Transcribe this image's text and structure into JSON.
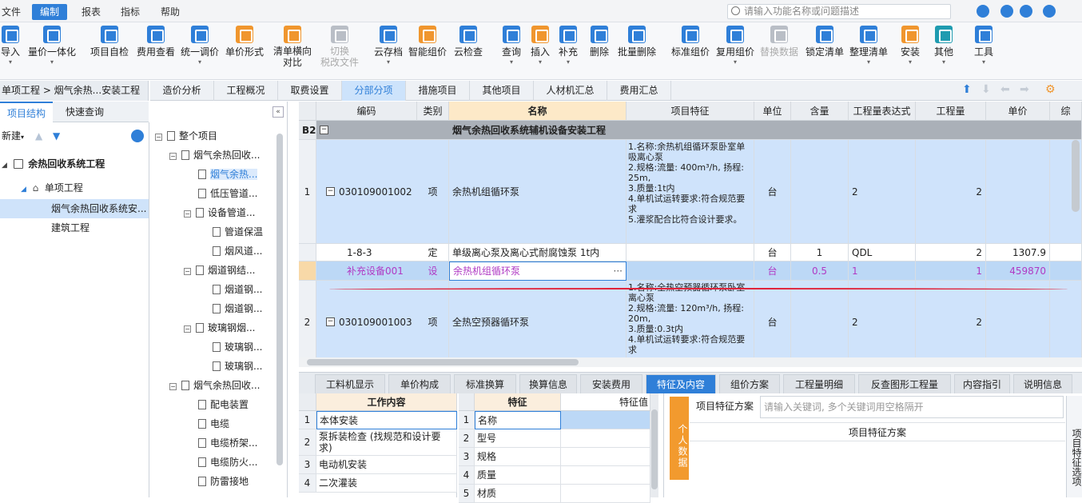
{
  "menu": {
    "items": [
      "文件",
      "编制",
      "报表",
      "指标",
      "帮助"
    ],
    "search_placeholder": "请输入功能名称或问题描述"
  },
  "toolbar": {
    "items": [
      {
        "l1": "导入",
        "l2": ""
      },
      {
        "l1": "量价一体化",
        "l2": ""
      },
      {
        "l1": "项目自检",
        "l2": ""
      },
      {
        "l1": "费用查看",
        "l2": ""
      },
      {
        "l1": "统一调价",
        "l2": ""
      },
      {
        "l1": "单价形式",
        "l2": ""
      },
      {
        "l1": "清单横向",
        "l2": "对比"
      },
      {
        "l1": "切换",
        "l2": "税改文件"
      },
      {
        "l1": "云存档",
        "l2": ""
      },
      {
        "l1": "智能组价",
        "l2": ""
      },
      {
        "l1": "云检查",
        "l2": ""
      },
      {
        "l1": "查询",
        "l2": ""
      },
      {
        "l1": "插入",
        "l2": ""
      },
      {
        "l1": "补充",
        "l2": ""
      },
      {
        "l1": "删除",
        "l2": ""
      },
      {
        "l1": "批量删除",
        "l2": ""
      },
      {
        "l1": "标准组价",
        "l2": ""
      },
      {
        "l1": "复用组价",
        "l2": ""
      },
      {
        "l1": "替换数据",
        "l2": ""
      },
      {
        "l1": "锁定清单",
        "l2": ""
      },
      {
        "l1": "整理清单",
        "l2": ""
      },
      {
        "l1": "安装",
        "l2": ""
      },
      {
        "l1": "其他",
        "l2": ""
      },
      {
        "l1": "工具",
        "l2": ""
      }
    ]
  },
  "left": {
    "breadcrumb": "单项工程 > 烟气余热...安装工程",
    "tabs": [
      "项目结构",
      "快速查询"
    ],
    "new_label": "新建",
    "tree": [
      "余热回收系统工程",
      "单项工程",
      "烟气余热回收系统安...",
      "建筑工程"
    ]
  },
  "middle": {
    "tree": [
      "整个项目",
      "烟气余热回收...",
      "烟气余热...",
      "低压管道...",
      "设备管道...",
      "管道保温",
      "烟风道...",
      "烟道钢结...",
      "烟道钢...",
      "烟道钢...",
      "玻璃钢烟...",
      "玻璃钢...",
      "玻璃钢...",
      "烟气余热回收...",
      "配电装置",
      "电缆",
      "电缆桥架...",
      "电缆防火...",
      "防雷接地"
    ]
  },
  "tabs": [
    "造价分析",
    "工程概况",
    "取费设置",
    "分部分项",
    "措施项目",
    "其他项目",
    "人材机汇总",
    "费用汇总"
  ],
  "grid": {
    "headers": [
      "编码",
      "类别",
      "名称",
      "项目特征",
      "单位",
      "含量",
      "工程量表达式",
      "工程量",
      "单价",
      "综"
    ],
    "b2": {
      "idx": "B2",
      "name": "烟气余热回收系统辅机设备安装工程"
    },
    "rows": [
      {
        "idx": "1",
        "code": "030109001002",
        "type": "项",
        "name": "余热机组循环泵",
        "feature": "1.名称:余热机组循环泵卧室单吸离心泵\n2.规格:流量: 400m³/h, 扬程: 25m,\n3.质量:1t内\n4.单机试运转要求:符合规范要求\n5.灌浆配合比符合设计要求。",
        "unit": "台",
        "content": "",
        "expr": "2",
        "qty": "2",
        "price": ""
      },
      {
        "idx": "",
        "code": "1-8-3",
        "type": "定",
        "name": "单级离心泵及离心式耐腐蚀泵 1t内",
        "feature": "",
        "unit": "台",
        "content": "1",
        "expr": "QDL",
        "qty": "2",
        "price": "1307.9"
      },
      {
        "idx": "",
        "code": "补充设备001",
        "type": "设",
        "name": "余热机组循环泵",
        "feature": "",
        "unit": "台",
        "content": "0.5",
        "expr": "1",
        "qty": "1",
        "price": "459870"
      },
      {
        "idx": "2",
        "code": "030109001003",
        "type": "项",
        "name": "全热空预器循环泵",
        "feature": "1.名称:全热空预器循环泵卧室离心泵\n2.规格:流量: 120m³/h, 扬程: 20m,\n3.质量:0.3t内\n4.单机试运转要求:符合规范要求",
        "unit": "台",
        "content": "",
        "expr": "2",
        "qty": "2",
        "price": ""
      }
    ]
  },
  "bottom_tabs": [
    "工料机显示",
    "单价构成",
    "标准换算",
    "换算信息",
    "安装费用",
    "特征及内容",
    "组价方案",
    "工程量明细",
    "反查图形工程量",
    "内容指引",
    "说明信息"
  ],
  "work_content": {
    "header": "工作内容",
    "items": [
      "本体安装",
      "泵拆装检查 (找规范和设计要求)",
      "电动机安装",
      "二次灌装"
    ]
  },
  "features": {
    "header": "特征",
    "value_header": "特征值",
    "items": [
      "名称",
      "型号",
      "规格",
      "质量",
      "材质"
    ]
  },
  "solution": {
    "personal_btn": "个人数据",
    "label": "项目特征方案",
    "placeholder": "请输入关键词, 多个关键词用空格隔开",
    "table_header": "项目特征方案",
    "side_tab": "项目特征选项"
  }
}
